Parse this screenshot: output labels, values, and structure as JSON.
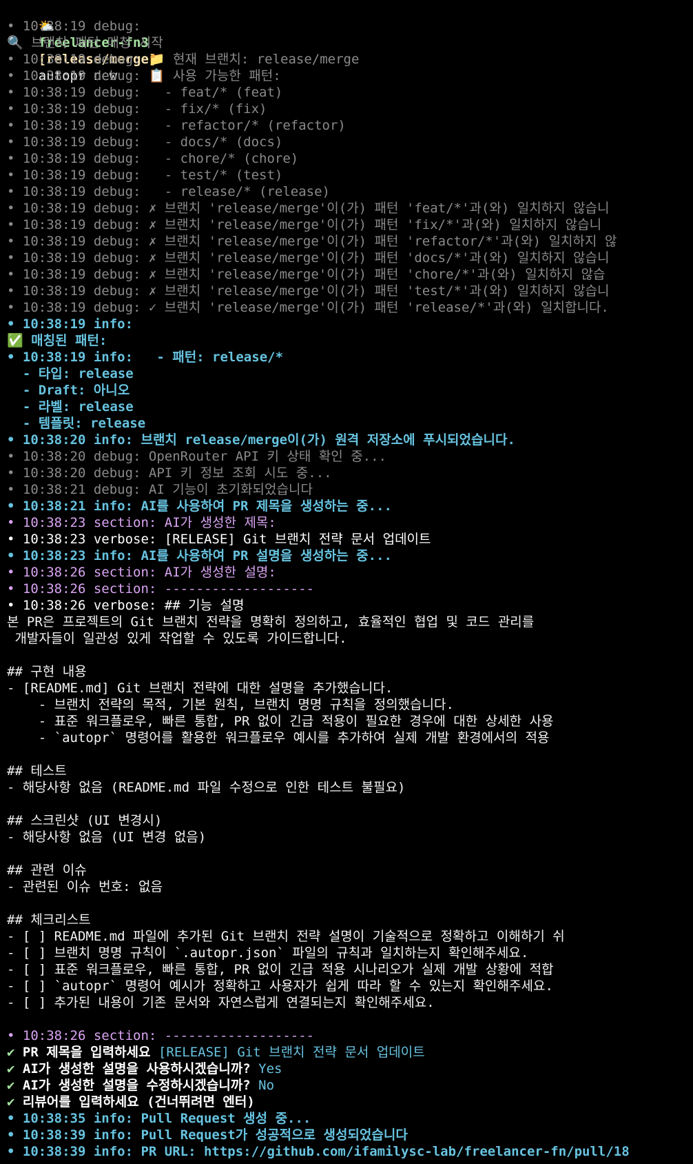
{
  "prompt": {
    "icon": "partly-cloudy-icon",
    "icon_glyph": "⛅",
    "directory": "freelancer-fn3",
    "branch": "[release/merge]",
    "command": "autopr new"
  },
  "lines": [
    {
      "s": "debug",
      "t": "• 10:38:19 debug:"
    },
    {
      "s": "debug",
      "t": "🔍 브랜치 패턴 매칭 시작"
    },
    {
      "s": "debug",
      "t": "• 10:38:19 debug: 📁 현재 브랜치: release/merge"
    },
    {
      "s": "debug",
      "t": "• 10:38:19 debug: 📋 사용 가능한 패턴:"
    },
    {
      "s": "debug",
      "t": "• 10:38:19 debug:   - feat/* (feat)"
    },
    {
      "s": "debug",
      "t": "• 10:38:19 debug:   - fix/* (fix)"
    },
    {
      "s": "debug",
      "t": "• 10:38:19 debug:   - refactor/* (refactor)"
    },
    {
      "s": "debug",
      "t": "• 10:38:19 debug:   - docs/* (docs)"
    },
    {
      "s": "debug",
      "t": "• 10:38:19 debug:   - chore/* (chore)"
    },
    {
      "s": "debug",
      "t": "• 10:38:19 debug:   - test/* (test)"
    },
    {
      "s": "debug",
      "t": "• 10:38:19 debug:   - release/* (release)"
    },
    {
      "s": "debug",
      "t": "• 10:38:19 debug: ✗ 브랜치 'release/merge'이(가) 패턴 'feat/*'과(와) 일치하지 않습니"
    },
    {
      "s": "debug",
      "t": "• 10:38:19 debug: ✗ 브랜치 'release/merge'이(가) 패턴 'fix/*'과(와) 일치하지 않습니"
    },
    {
      "s": "debug",
      "t": "• 10:38:19 debug: ✗ 브랜치 'release/merge'이(가) 패턴 'refactor/*'과(와) 일치하지 않"
    },
    {
      "s": "debug",
      "t": "• 10:38:19 debug: ✗ 브랜치 'release/merge'이(가) 패턴 'docs/*'과(와) 일치하지 않습니"
    },
    {
      "s": "debug",
      "t": "• 10:38:19 debug: ✗ 브랜치 'release/merge'이(가) 패턴 'chore/*'과(와) 일치하지 않습"
    },
    {
      "s": "debug",
      "t": "• 10:38:19 debug: ✗ 브랜치 'release/merge'이(가) 패턴 'test/*'과(와) 일치하지 않습니"
    },
    {
      "s": "debug",
      "t": "• 10:38:19 debug: ✓ 브랜치 'release/merge'이(가) 패턴 'release/*'과(와) 일치합니다."
    },
    {
      "s": "info",
      "t": "• 10:38:19 info:"
    },
    {
      "s": "info",
      "t": "✅ 매칭된 패턴:"
    },
    {
      "s": "info",
      "t": "• 10:38:19 info:   - 패턴: release/*"
    },
    {
      "s": "info",
      "t": "  - 타입: release"
    },
    {
      "s": "info",
      "t": "  - Draft: 아니오"
    },
    {
      "s": "info",
      "t": "  - 라벨: release"
    },
    {
      "s": "info",
      "t": "  - 템플릿: release"
    },
    {
      "s": "info",
      "t": "• 10:38:20 info: 브랜치 release/merge이(가) 원격 저장소에 푸시되었습니다."
    },
    {
      "s": "debug",
      "t": "• 10:38:20 debug: OpenRouter API 키 상태 확인 중..."
    },
    {
      "s": "debug",
      "t": "• 10:38:20 debug: API 키 정보 조회 시도 중..."
    },
    {
      "s": "debug",
      "t": "• 10:38:21 debug: AI 기능이 초기화되었습니다"
    },
    {
      "s": "info",
      "t": "• 10:38:21 info: AI를 사용하여 PR 제목을 생성하는 중..."
    },
    {
      "s": "section",
      "t": "• 10:38:23 section: AI가 생성한 제목:"
    },
    {
      "s": "verbose",
      "t": "• 10:38:23 verbose: [RELEASE] Git 브랜치 전략 문서 업데이트"
    },
    {
      "s": "info",
      "t": "• 10:38:23 info: AI를 사용하여 PR 설명을 생성하는 중..."
    },
    {
      "s": "section",
      "t": "• 10:38:26 section: AI가 생성한 설명:"
    },
    {
      "s": "section",
      "t": "• 10:38:26 section: -------------------"
    },
    {
      "s": "verbose",
      "t": "• 10:38:26 verbose: ## 기능 설명"
    },
    {
      "s": "body-text",
      "t": "본 PR은 프로젝트의 Git 브랜치 전략을 명확히 정의하고, 효율적인 협업 및 코드 관리를"
    },
    {
      "s": "body-text",
      "t": " 개발자들이 일관성 있게 작업할 수 있도록 가이드합니다."
    },
    {
      "s": "body-text",
      "t": ""
    },
    {
      "s": "body-text",
      "t": "## 구현 내용"
    },
    {
      "s": "body-text",
      "t": "- [README.md] Git 브랜치 전략에 대한 설명을 추가했습니다."
    },
    {
      "s": "body-text",
      "t": "    - 브랜치 전략의 목적, 기본 원칙, 브랜치 명명 규칙을 정의했습니다."
    },
    {
      "s": "body-text",
      "t": "    - 표준 워크플로우, 빠른 통합, PR 없이 긴급 적용이 필요한 경우에 대한 상세한 사용"
    },
    {
      "s": "body-text",
      "t": "    - `autopr` 명령어를 활용한 워크플로우 예시를 추가하여 실제 개발 환경에서의 적용"
    },
    {
      "s": "body-text",
      "t": ""
    },
    {
      "s": "body-text",
      "t": "## 테스트"
    },
    {
      "s": "body-text",
      "t": "- 해당사항 없음 (README.md 파일 수정으로 인한 테스트 불필요)"
    },
    {
      "s": "body-text",
      "t": ""
    },
    {
      "s": "body-text",
      "t": "## 스크린샷 (UI 변경시)"
    },
    {
      "s": "body-text",
      "t": "- 해당사항 없음 (UI 변경 없음)"
    },
    {
      "s": "body-text",
      "t": ""
    },
    {
      "s": "body-text",
      "t": "## 관련 이슈"
    },
    {
      "s": "body-text",
      "t": "- 관련된 이슈 번호: 없음"
    },
    {
      "s": "body-text",
      "t": ""
    },
    {
      "s": "body-text",
      "t": "## 체크리스트"
    },
    {
      "s": "body-text",
      "t": "- [ ] README.md 파일에 추가된 Git 브랜치 전략 설명이 기술적으로 정확하고 이해하기 쉬"
    },
    {
      "s": "body-text",
      "t": "- [ ] 브랜치 명명 규칙이 `.autopr.json` 파일의 규칙과 일치하는지 확인해주세요."
    },
    {
      "s": "body-text",
      "t": "- [ ] 표준 워크플로우, 빠른 통합, PR 없이 긴급 적용 시나리오가 실제 개발 상황에 적합"
    },
    {
      "s": "body-text",
      "t": "- [ ] `autopr` 명령어 예시가 정확하고 사용자가 쉽게 따라 할 수 있는지 확인해주세요."
    },
    {
      "s": "body-text",
      "t": "- [ ] 추가된 내용이 기존 문서와 자연스럽게 연결되는지 확인해주세요."
    },
    {
      "s": "body-text",
      "t": ""
    },
    {
      "s": "section",
      "t": "• 10:38:26 section: -------------------"
    }
  ],
  "prompts": [
    {
      "check": "✔",
      "question": "PR 제목을 입력하세요",
      "answer": "[RELEASE] Git 브랜치 전략 문서 업데이트"
    },
    {
      "check": "✔",
      "question": "AI가 생성한 설명을 사용하시겠습니까?",
      "answer": "Yes"
    },
    {
      "check": "✔",
      "question": "AI가 생성한 설명을 수정하시겠습니까?",
      "answer": "No"
    },
    {
      "check": "✔",
      "question": "리뷰어를 입력하세요 (건너뛰려면 엔터)",
      "answer": ""
    }
  ],
  "tail": [
    {
      "s": "info",
      "t": "• 10:38:35 info: Pull Request 생성 중..."
    },
    {
      "s": "info",
      "t": "• 10:38:39 info: Pull Request가 성공적으로 생성되었습니다"
    },
    {
      "s": "info",
      "t": "• 10:38:39 info: PR URL: https://github.com/ifamilysc-lab/freelancer-fn/pull/18"
    }
  ],
  "colors": {
    "background": "#000000",
    "debug": "#8a8a8a",
    "info": "#67c3e0",
    "section": "#d9a4f2",
    "verbose": "#ffffff",
    "prompt_dir": "#a6e3a1",
    "prompt_branch": "#f9e2af"
  }
}
